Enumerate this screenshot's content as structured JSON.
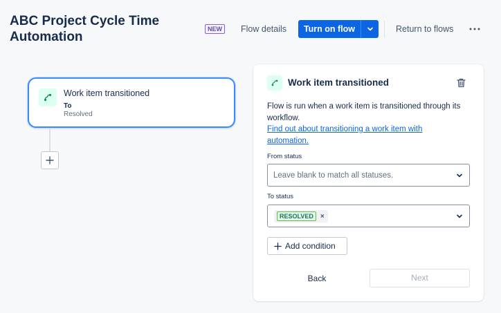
{
  "header": {
    "title": "ABC Project Cycle Time Automation",
    "new_badge": "NEW",
    "flow_details": "Flow details",
    "turn_on_flow": "Turn on flow",
    "return_to_flows": "Return to flows",
    "more_icon": "more-horizontal-icon"
  },
  "canvas": {
    "trigger_card": {
      "icon": "transition-icon",
      "title": "Work item transitioned",
      "sub_label": "To",
      "value": "Resolved"
    },
    "add_step_icon": "plus-icon"
  },
  "panel": {
    "icon": "transition-icon",
    "title": "Work item transitioned",
    "delete_icon": "trash-icon",
    "description": "Flow is run when a work item is transitioned through its workflow.",
    "link": "Find out about transitioning a work item with automation.",
    "from_status": {
      "label": "From status",
      "placeholder": "Leave blank to match all statuses."
    },
    "to_status": {
      "label": "To status",
      "selected": [
        "RESOLVED"
      ]
    },
    "add_condition": "Add condition",
    "back": "Back",
    "next": "Next"
  },
  "colors": {
    "primary": "#0c66e4",
    "trigger_border": "#388bff",
    "icon_bg": "#dcfff1",
    "icon_fg": "#1f845a",
    "resolved_lozenge_border": "#6bb93b"
  }
}
